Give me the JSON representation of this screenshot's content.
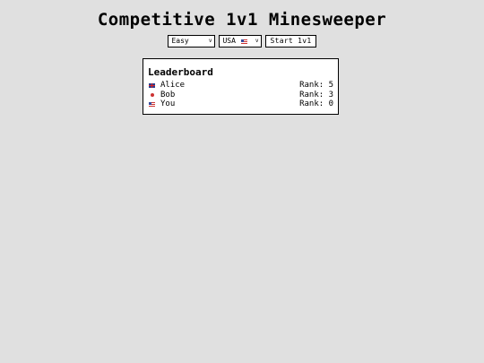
{
  "app": {
    "title": "Competitive 1v1 Minesweeper"
  },
  "controls": {
    "difficulty": {
      "selected": "Easy",
      "caret": "v"
    },
    "country": {
      "selected": "USA",
      "flag_icon": "us-flag-icon",
      "caret": "v"
    },
    "start_label": "Start 1v1"
  },
  "leaderboard": {
    "title": "Leaderboard",
    "rows": [
      {
        "name": "Alice",
        "flag_icon": "uk-flag-icon",
        "rank": "Rank: 5"
      },
      {
        "name": "Bob",
        "flag_icon": "red-dot-flag-icon",
        "rank": "Rank: 3"
      },
      {
        "name": "You",
        "flag_icon": "us-flag-icon",
        "rank": "Rank: 0"
      }
    ]
  },
  "colors": {
    "background": "#e0e0e0",
    "panel": "#ffffff",
    "text": "#000000"
  }
}
